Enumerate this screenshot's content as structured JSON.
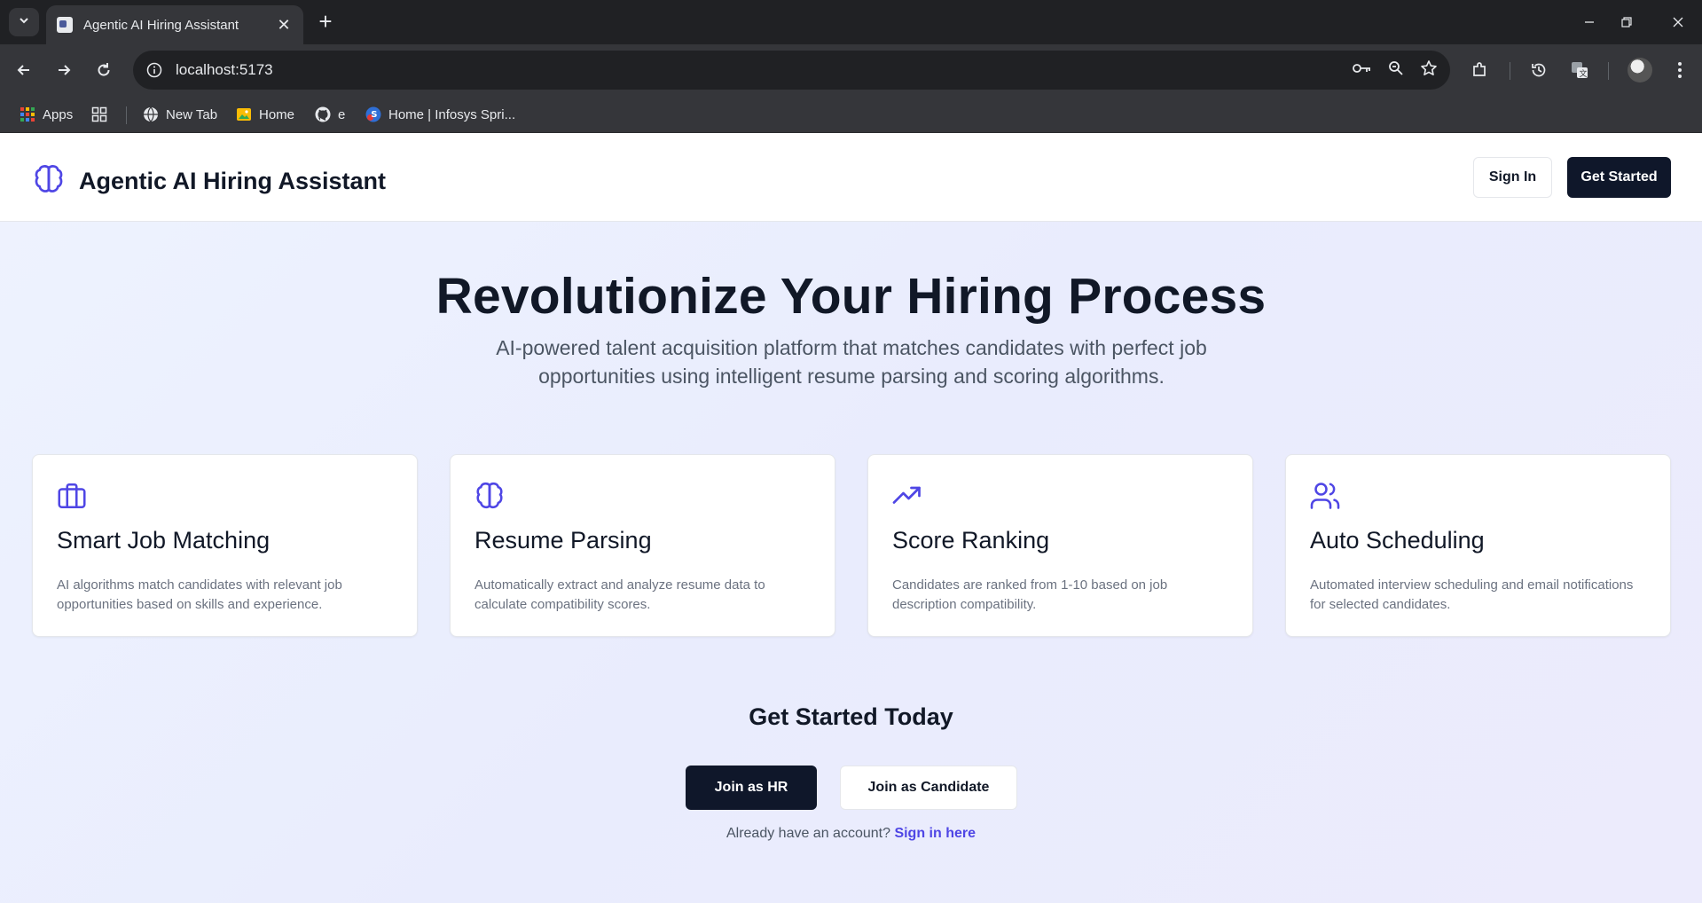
{
  "browser": {
    "tab_title": "Agentic AI Hiring Assistant",
    "url": "localhost:5173",
    "bookmarks": [
      "Apps",
      "New Tab",
      "Home",
      "e",
      "Home | Infosys Spri..."
    ]
  },
  "header": {
    "brand": "Agentic AI Hiring Assistant",
    "sign_in": "Sign In",
    "get_started": "Get Started"
  },
  "hero": {
    "title": "Revolutionize Your Hiring Process",
    "subtitle": "AI-powered talent acquisition platform that matches candidates with perfect job opportunities using intelligent resume parsing and scoring algorithms."
  },
  "features": [
    {
      "icon": "briefcase-icon",
      "title": "Smart Job Matching",
      "description": "AI algorithms match candidates with relevant job opportunities based on skills and experience."
    },
    {
      "icon": "brain-icon",
      "title": "Resume Parsing",
      "description": "Automatically extract and analyze resume data to calculate compatibility scores."
    },
    {
      "icon": "trending-up-icon",
      "title": "Score Ranking",
      "description": "Candidates are ranked from 1-10 based on job description compatibility."
    },
    {
      "icon": "users-icon",
      "title": "Auto Scheduling",
      "description": "Automated interview scheduling and email notifications for selected candidates."
    }
  ],
  "cta": {
    "title": "Get Started Today",
    "join_hr": "Join as HR",
    "join_candidate": "Join as Candidate",
    "already_text": "Already have an account?",
    "sign_in_link": "Sign in here"
  },
  "colors": {
    "accent": "#4f46e5",
    "primary_button": "#0f172a"
  }
}
